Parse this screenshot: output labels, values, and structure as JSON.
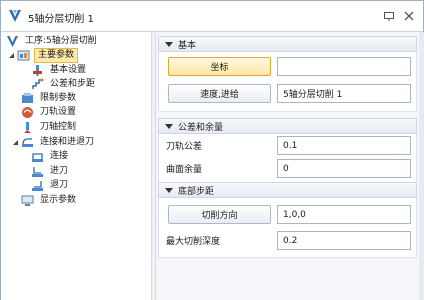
{
  "window": {
    "title": "5轴分层切削 1"
  },
  "tree": {
    "items": [
      {
        "label": "工序:5轴分层切削",
        "icon": "operation-icon"
      },
      {
        "label": "主要参数",
        "icon": "main-params-icon"
      },
      {
        "label": "基本设置",
        "icon": "basic-settings-icon"
      },
      {
        "label": "公差和步距",
        "icon": "tolerance-icon"
      },
      {
        "label": "限制参数",
        "icon": "limit-params-icon"
      },
      {
        "label": "刀轨设置",
        "icon": "toolpath-settings-icon"
      },
      {
        "label": "刀轴控制",
        "icon": "tool-axis-icon"
      },
      {
        "label": "连接和进退刀",
        "icon": "link-lead-icon"
      },
      {
        "label": "连接",
        "icon": "link-icon"
      },
      {
        "label": "进刀",
        "icon": "lead-in-icon"
      },
      {
        "label": "退刀",
        "icon": "lead-out-icon"
      },
      {
        "label": "显示参数",
        "icon": "display-params-icon"
      }
    ]
  },
  "sections": {
    "basic": {
      "header": "基本",
      "coord_label": "坐标",
      "coord_value": "",
      "speed_label": "速度,进给",
      "speed_value": "5轴分层切削 1"
    },
    "tolerance": {
      "header": "公差和余量",
      "path_tol_label": "刀轨公差",
      "path_tol_value": "0.1",
      "surface_stock_label": "曲面余量",
      "surface_stock_value": "0"
    },
    "bottom_step": {
      "header": "底部步距",
      "cut_dir_label": "切削方向",
      "cut_dir_value": "1,0,0",
      "max_depth_label": "最大切削深度",
      "max_depth_value": "0.2"
    }
  },
  "colors": {
    "selected_bg": "#ffe9a8",
    "accent": "#2f6db5"
  }
}
